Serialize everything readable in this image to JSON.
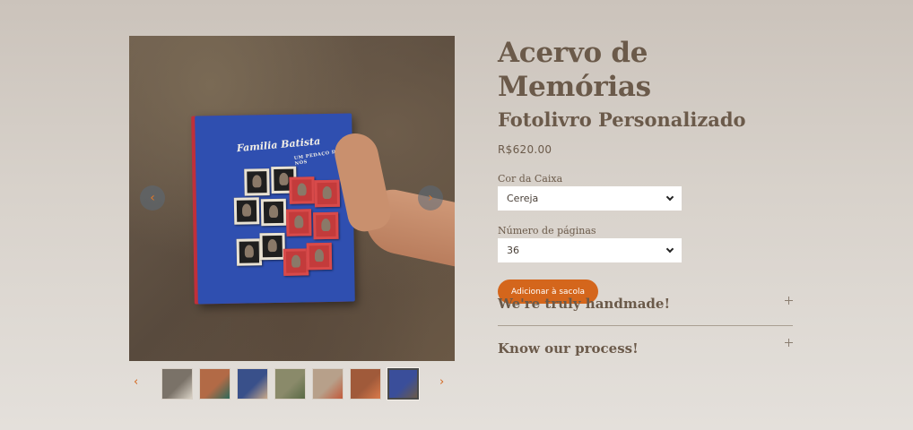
{
  "product": {
    "title": "Acervo de Memórias",
    "subtitle": "Fotolivro Personalizado",
    "price": "R$620.00"
  },
  "image": {
    "book_title": "Familia Batista",
    "book_subtitle": "UM PEDAÇO DE NÓS"
  },
  "options": {
    "box_color_label": "Cor da Caixa",
    "box_color_value": "Cereja",
    "pages_label": "Número de páginas",
    "pages_value": "36"
  },
  "actions": {
    "add_to_bag": "Adicionar à sacola"
  },
  "accordion": [
    {
      "title": "We're truly handmade!"
    },
    {
      "title": "Know our process!"
    }
  ],
  "icons": {
    "prev": "chevron-left-icon",
    "next": "chevron-right-icon",
    "expand": "plus-icon",
    "select": "chevron-down-icon"
  },
  "thumbnails": [
    {
      "color": "#7a7268",
      "accent": "#d9d2c6"
    },
    {
      "color": "#b26a46",
      "accent": "#2f6a5a"
    },
    {
      "color": "#39508a",
      "accent": "#c9a98a"
    },
    {
      "color": "#8a8a6a",
      "accent": "#5a6a45"
    },
    {
      "color": "#b7a08a",
      "accent": "#c25a3a"
    },
    {
      "color": "#a05a3a",
      "accent": "#d97a4a"
    },
    {
      "color": "#3a4e9a",
      "accent": "#6a5a4a"
    }
  ],
  "active_thumbnail": 7,
  "colors": {
    "accent": "#d4661c",
    "text": "#6b5a4a"
  }
}
